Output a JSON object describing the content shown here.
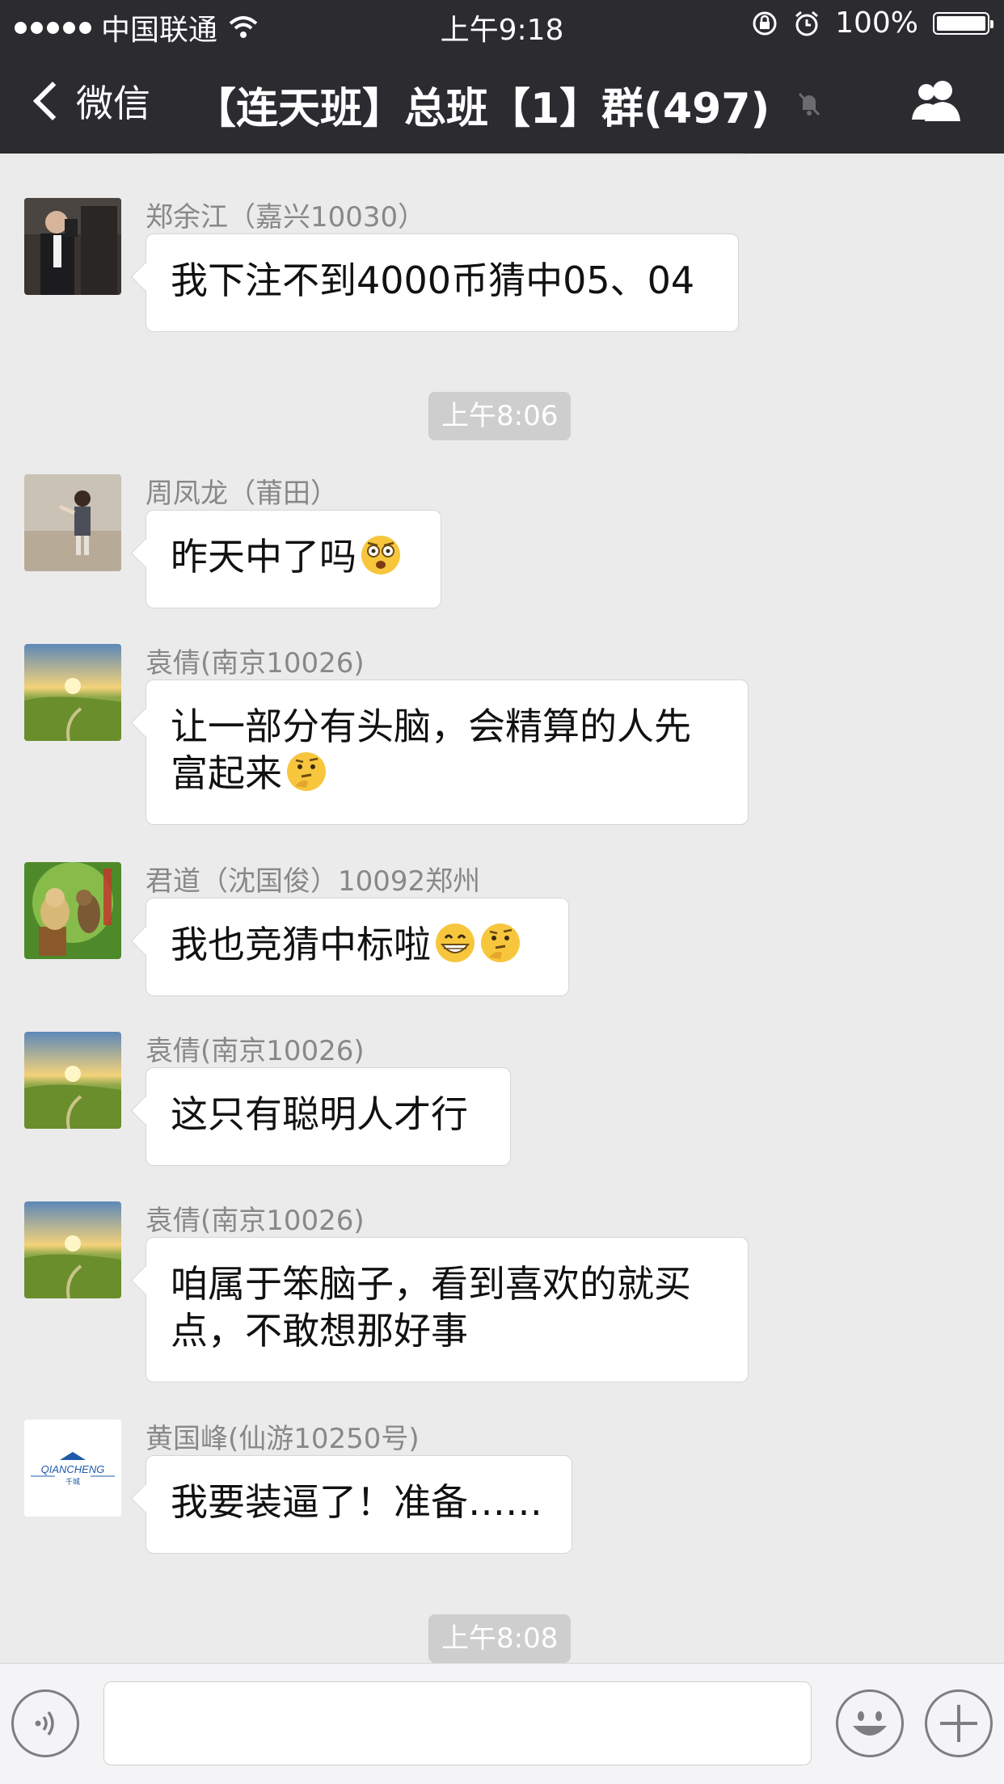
{
  "status_bar": {
    "carrier": "中国联通",
    "time": "上午9:18",
    "battery": "100%"
  },
  "nav": {
    "back_label": "微信",
    "title": "【连天班】总班【1】群(497)"
  },
  "timestamps": [
    "上午8:06",
    "上午8:08"
  ],
  "messages": [
    {
      "sender": "郑余江（嘉兴10030）",
      "text": "我下注不到4000币猜中05、04",
      "emoji": []
    },
    {
      "sender": "周凤龙（莆田）",
      "text": "昨天中了吗",
      "emoji": [
        "astonished-face"
      ]
    },
    {
      "sender": "袁倩(南京10026)",
      "text_lines": [
        "让一部分有头脑，会精算的人先",
        "富起来"
      ],
      "emoji": [
        "thinking-face"
      ]
    },
    {
      "sender": "君道（沈国俊）10092郑州",
      "text": "我也竞猜中标啦",
      "emoji": [
        "grinning-face",
        "thinking-face"
      ]
    },
    {
      "sender": "袁倩(南京10026)",
      "text": "这只有聪明人才行",
      "emoji": []
    },
    {
      "sender": "袁倩(南京10026)",
      "text_lines": [
        "咱属于笨脑子，看到喜欢的就买",
        "点，不敢想那好事"
      ],
      "emoji": []
    },
    {
      "sender": "黄国峰(仙游10250号)",
      "text": "我要装逼了！准备……",
      "emoji": []
    }
  ],
  "avatar_logo": {
    "brand": "QIANCHENG",
    "sub": "千城"
  },
  "input_bar": {
    "placeholder": "",
    "icons": [
      "voice-icon",
      "emoji-icon",
      "add-icon"
    ]
  },
  "colors": {
    "nav_bg": "#2b2b30",
    "chat_bg": "#ebebeb",
    "bubble_bg": "#ffffff",
    "timestamp_bg": "#cecece"
  }
}
